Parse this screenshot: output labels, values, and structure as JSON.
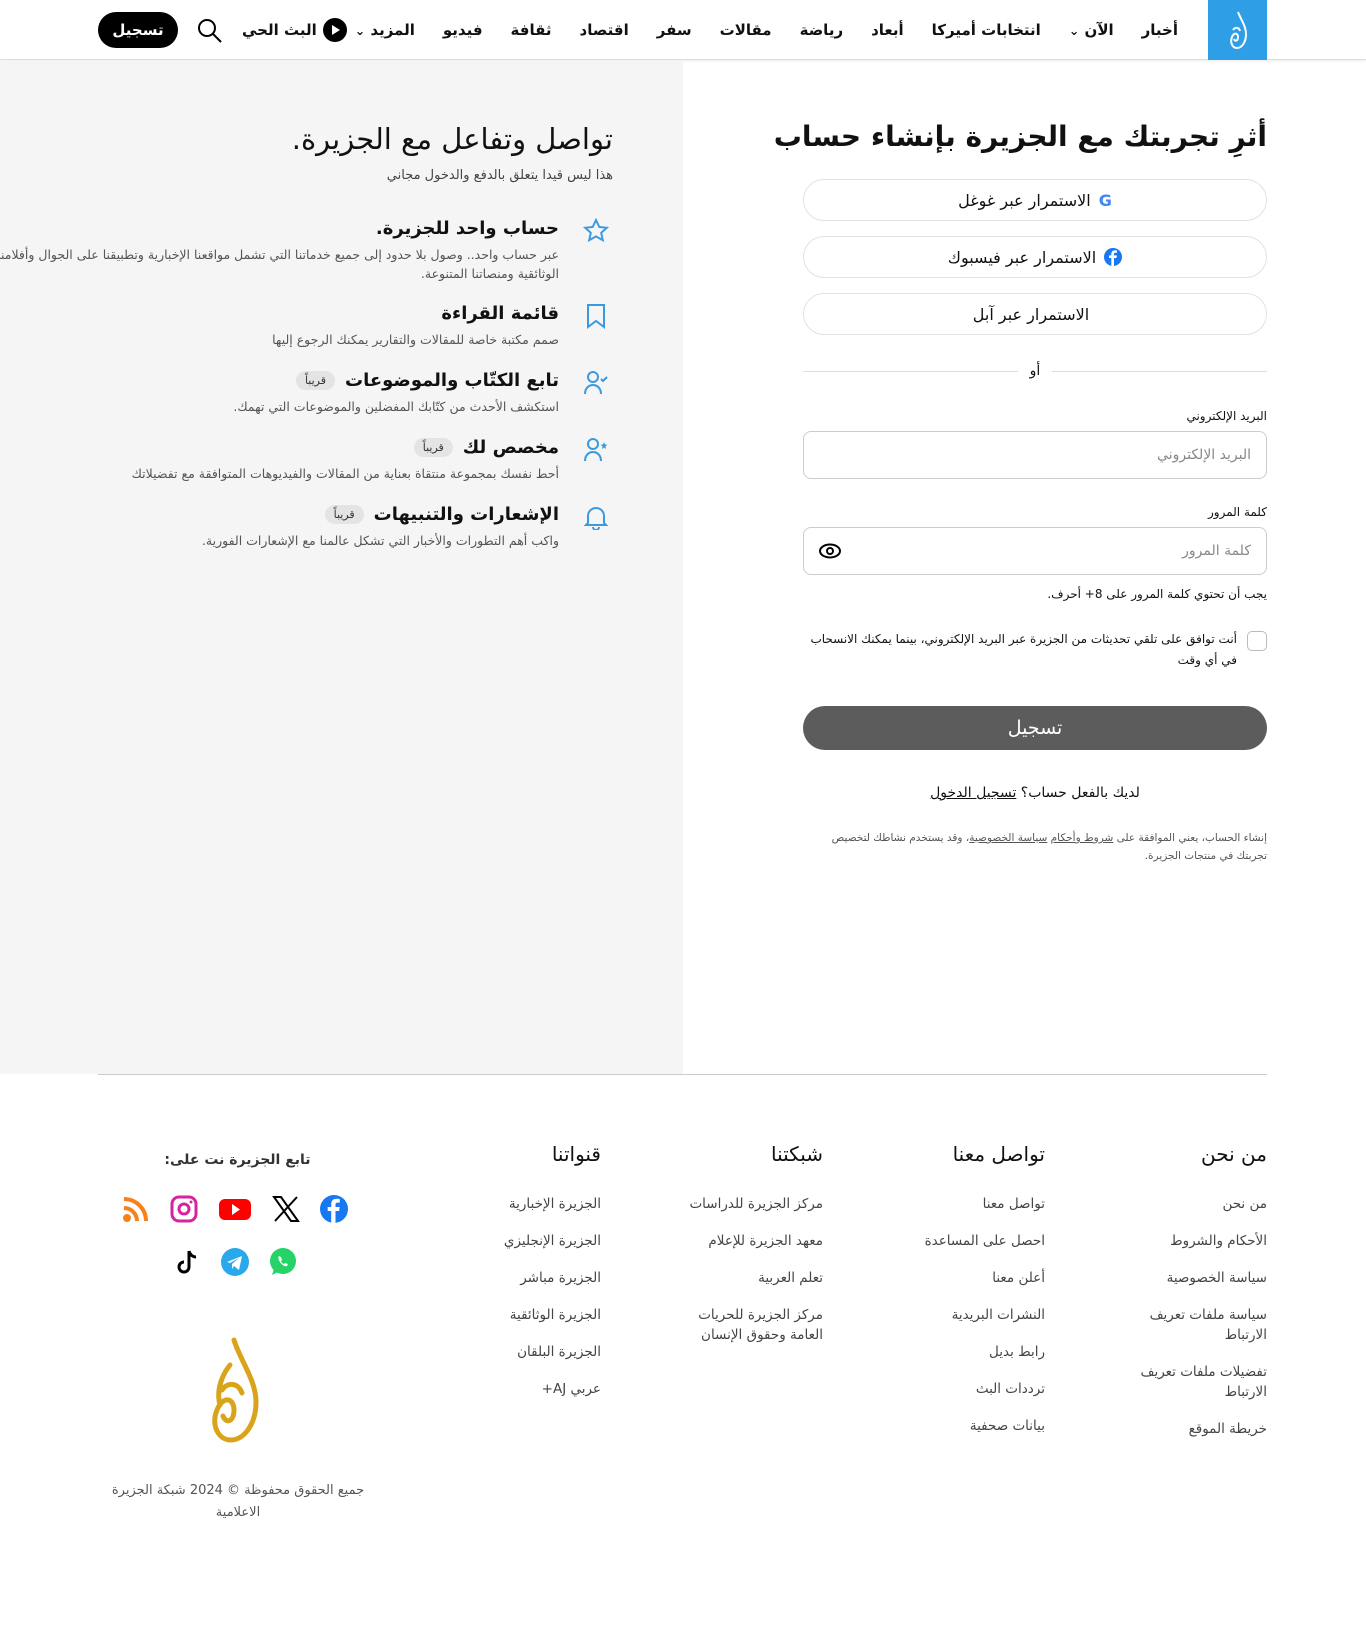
{
  "header": {
    "nav": [
      "أخبار",
      "الآن",
      "انتخابات أميركا",
      "أبعاد",
      "رياضة",
      "مقالات",
      "سفر",
      "اقتصاد",
      "ثقافة",
      "فيديو",
      "المزيد"
    ],
    "live": "البث الحي",
    "register": "تسجيل"
  },
  "left": {
    "title": "تواصل وتفاعل مع الجزيرة.",
    "subtitle": "هذا ليس قيدا يتعلق بالدفع والدخول مجاني",
    "features": [
      {
        "title": "حساب واحد للجزيرة.",
        "desc": "عبر حساب واحد.. وصول بلا حدود إلى جميع خدماتنا التي تشمل مواقعنا الإخبارية وتطبيقنا على الجوال وأفلامنا الوثائقية ومنصاتنا المتنوعة.",
        "icon": "star-icon"
      },
      {
        "title": "قائمة القراءة",
        "desc": "صمم مكتبة خاصة للمقالات والتقارير يمكنك الرجوع إليها",
        "icon": "bookmark-icon"
      },
      {
        "title": "تابع الكتّاب والموضوعات",
        "badge": "قريباً",
        "desc": "استكشف الأحدث من كتّابك المفضلين والموضوعات التي تهمك.",
        "icon": "user-check-icon"
      },
      {
        "title": "مخصص لك",
        "badge": "قريباً",
        "desc": "أحط نفسك بمجموعة منتقاة بعناية من المقالات والفيديوهات المتوافقة مع تفضيلاتك",
        "icon": "user-star-icon"
      },
      {
        "title": "الإشعارات والتنبيهات",
        "badge": "قريباً",
        "desc": "واكب أهم التطورات والأخبار التي تشكل عالمنا مع الإشعارات الفورية.",
        "icon": "bell-icon"
      }
    ]
  },
  "form": {
    "title": "أثرِ تجربتك مع الجزيرة بإنشاء حساب",
    "google": "الاستمرار عبر غوغل",
    "facebook": "الاستمرار عبر فيسبوك",
    "apple": "الاستمرار عبر آبل",
    "or": "أو",
    "email_label": "البريد الإلكتروني",
    "email_placeholder": "البريد الإلكتروني",
    "password_label": "كلمة المرور",
    "password_placeholder": "كلمة المرور",
    "password_hint": "يجب أن تحتوي كلمة المرور على 8+ أحرف.",
    "consent": "أنت توافق على تلقي تحديثات من الجزيرة عبر البريد الإلكتروني، بينما يمكنك الانسحاب في أي وقت",
    "submit": "تسجيل",
    "have_account": "لديك بالفعل حساب؟",
    "login": "تسجيل الدخول",
    "legal_1": "إنشاء الحساب، يعني الموافقة على ",
    "terms": "شروط وأحكام",
    "legal_2": " ",
    "privacy": "سياسة الخصوصية",
    "legal_3": "، وقد يستخدم نشاطك لتخصيص تجربتك في منتجات الجزيرة."
  },
  "footer": {
    "columns": [
      {
        "title": "من نحن",
        "links": [
          "من نحن",
          "الأحكام والشروط",
          "سياسة الخصوصية",
          "سياسة ملفات تعريف الارتباط",
          "تفضيلات ملفات تعريف الارتباط",
          "خريطة الموقع"
        ]
      },
      {
        "title": "تواصل معنا",
        "links": [
          "تواصل معنا",
          "احصل على المساعدة",
          "أعلن معنا",
          "النشرات البريدية",
          "رابط بديل",
          "ترددات البث",
          "بيانات صحفية"
        ]
      },
      {
        "title": "شبكتنا",
        "links": [
          "مركز الجزيرة للدراسات",
          "معهد الجزيرة للإعلام",
          "تعلم العربية",
          "مركز الجزيرة للحريات العامة وحقوق الإنسان"
        ]
      },
      {
        "title": "قنواتنا",
        "links": [
          "الجزيرة الإخبارية",
          "الجزيرة الإنجليزي",
          "الجزيرة مباشر",
          "الجزيرة الوثائقية",
          "الجزيرة البلقان",
          "عربي AJ+"
        ]
      }
    ],
    "follow": "تابع الجزيرة نت على:",
    "copyright": "جميع الحقوق محفوظة © 2024 شبكة الجزيرة الاعلامية"
  },
  "colors": {
    "brand": "#2e9ee6",
    "gold": "#d9a31a",
    "icon": "#3a9ae0"
  }
}
